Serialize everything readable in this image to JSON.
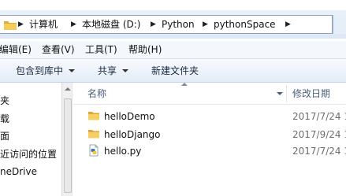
{
  "address": {
    "crumbs": [
      "计算机",
      "本地磁盘 (D:)",
      "Python",
      "pythonSpace"
    ],
    "separator": "▶"
  },
  "menu": [
    "编辑(E)",
    "查看(V)",
    "工具(T)",
    "帮助(H)"
  ],
  "toolbar": {
    "include_library": "包含到库中",
    "share": "共享",
    "new_folder": "新建文件夹"
  },
  "nav": [
    "夹",
    "载",
    "面",
    "近访问的位置",
    "neDrive"
  ],
  "columns": {
    "name": "名称",
    "modified": "修改日期"
  },
  "files": [
    {
      "name": "helloDemo",
      "date": "2017/7/24 1",
      "icon": "folder-icon"
    },
    {
      "name": "helloDjango",
      "date": "2017/9/24 1",
      "icon": "folder-icon"
    },
    {
      "name": "hello.py",
      "date": "2017/7/24 1",
      "icon": "python-file-icon"
    }
  ],
  "colors": {
    "folder": "#f2c44d",
    "header_text": "#4c607a",
    "date_text": "#6d6d6d"
  }
}
